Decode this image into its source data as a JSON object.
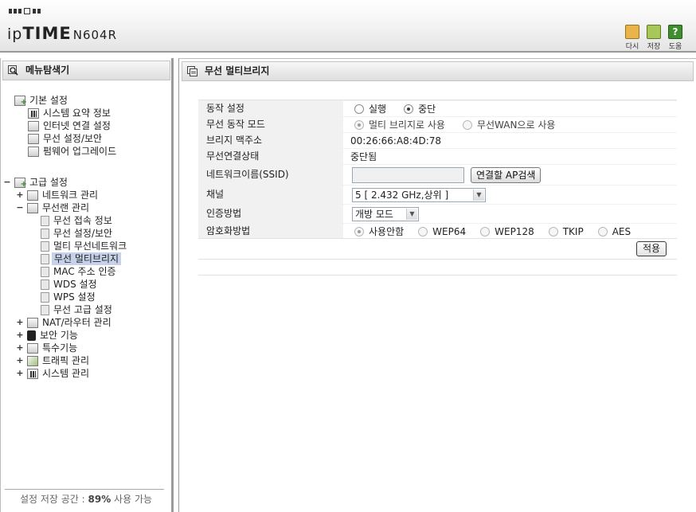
{
  "header": {
    "logo_ip": "ip",
    "logo_time": "TIME",
    "model": "N604R",
    "buttons": [
      {
        "label": "다시",
        "icon": "home-icon"
      },
      {
        "label": "저장",
        "icon": "save-icon"
      },
      {
        "label": "도움",
        "icon": "help-icon",
        "glyph": "?"
      }
    ]
  },
  "sidebar": {
    "title": "메뉴탐색기",
    "basic": {
      "label": "기본 설정",
      "items": [
        "시스템 요약 정보",
        "인터넷 연결 설정",
        "무선 설정/보안",
        "펌웨어 업그레이드"
      ]
    },
    "advanced": {
      "toggle": "−",
      "label": "고급 설정",
      "network": {
        "toggle": "+",
        "label": "네트워크 관리"
      },
      "wireless": {
        "toggle": "−",
        "label": "무선랜 관리",
        "items": [
          "무선 접속 정보",
          "무선 설정/보안",
          "멀티 무선네트워크",
          "무선 멀티브리지",
          "MAC 주소 인증",
          "WDS 설정",
          "WPS 설정",
          "무선 고급 설정"
        ],
        "selected": "무선 멀티브리지"
      },
      "others": [
        {
          "toggle": "+",
          "label": "NAT/라우터 관리"
        },
        {
          "toggle": "+",
          "label": "보안 기능"
        },
        {
          "toggle": "+",
          "label": "특수기능"
        },
        {
          "toggle": "+",
          "label": "트래픽 관리"
        },
        {
          "toggle": "+",
          "label": "시스템 관리"
        }
      ]
    },
    "quota_prefix": "설정 저장 공간 : ",
    "quota_value": "89%",
    "quota_suffix": " 사용 가능"
  },
  "main": {
    "title": "무선 멀티브리지",
    "rows": {
      "operation": {
        "label": "동작 설정",
        "opt1": "실행",
        "opt2": "중단",
        "selected": "중단"
      },
      "mode": {
        "label": "무선 동작 모드",
        "opt1": "멀티 브리지로 사용",
        "opt2": "무선WAN으로 사용",
        "selected": "멀티 브리지로 사용"
      },
      "mac": {
        "label": "브리지 맥주소",
        "value": "00:26:66:A8:4D:78"
      },
      "status": {
        "label": "무선연결상태",
        "value": "중단됨"
      },
      "ssid": {
        "label": "네트워크이름(SSID)",
        "value": "",
        "button": "연결할 AP검색"
      },
      "channel": {
        "label": "채널",
        "value": "5 [ 2.432 GHz,상위 ]"
      },
      "auth": {
        "label": "인증방법",
        "value": "개방 모드"
      },
      "enc": {
        "label": "암호화방법",
        "options": [
          "사용안함",
          "WEP64",
          "WEP128",
          "TKIP",
          "AES"
        ],
        "selected": "사용안함"
      }
    },
    "apply": "적용"
  }
}
